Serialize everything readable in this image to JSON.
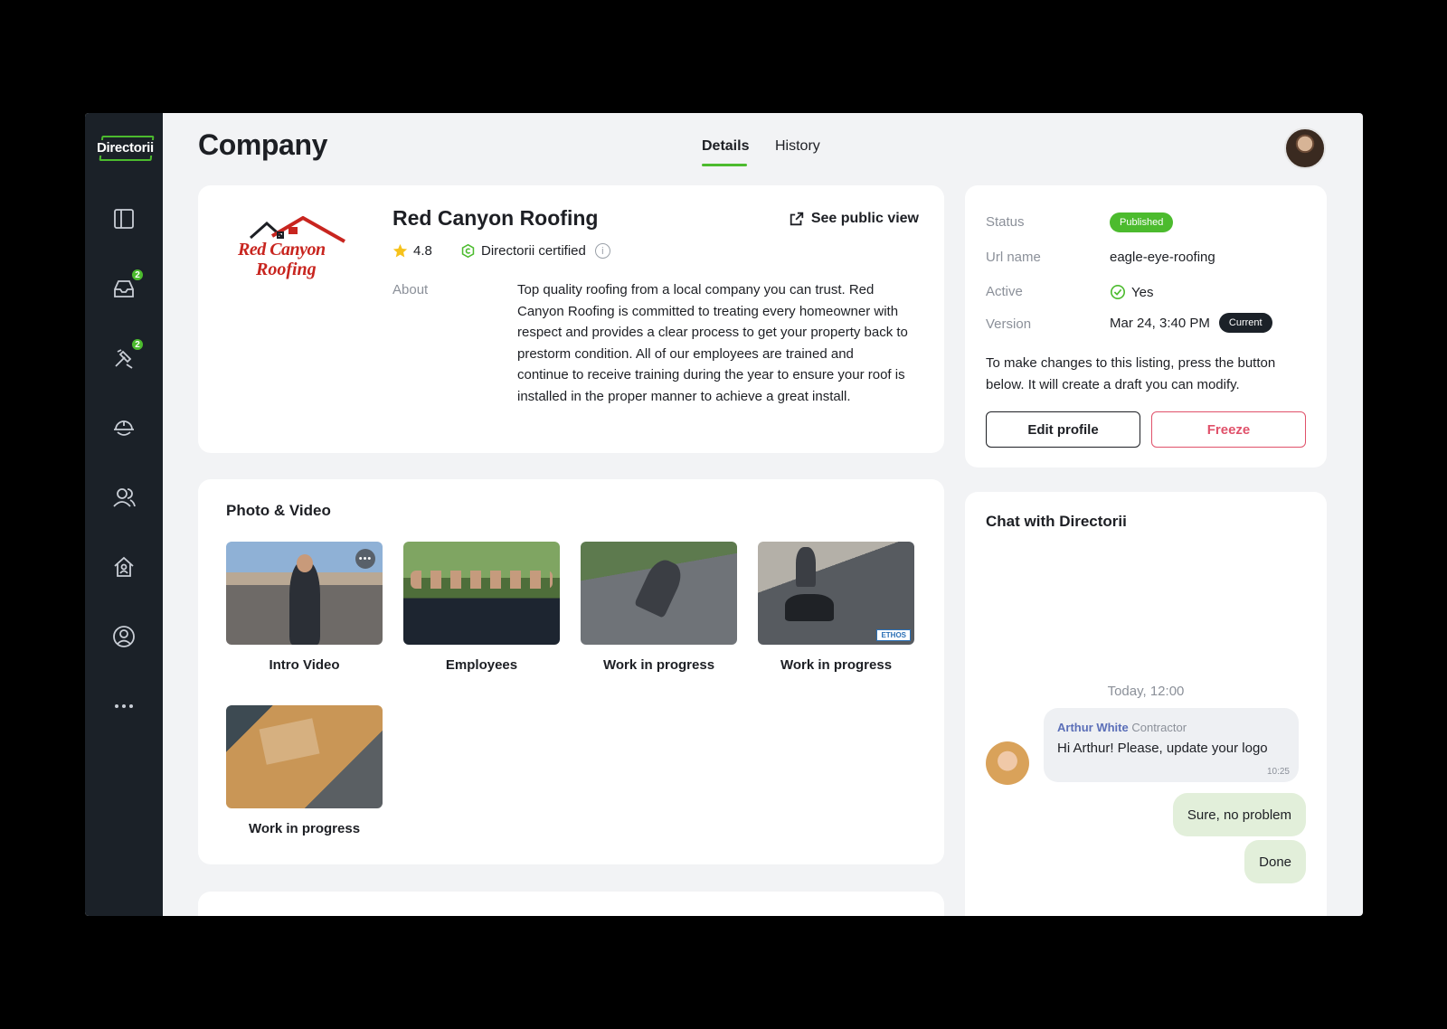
{
  "sidebar": {
    "logo_text": "Directorii",
    "items": [
      {
        "icon": "layout-panel-icon",
        "badge": ""
      },
      {
        "icon": "inbox-icon",
        "badge": "2"
      },
      {
        "icon": "tools-icon",
        "badge": "2"
      },
      {
        "icon": "hard-hat-icon",
        "badge": ""
      },
      {
        "icon": "users-icon",
        "badge": ""
      },
      {
        "icon": "home-icon",
        "badge": ""
      },
      {
        "icon": "profile-icon",
        "badge": ""
      },
      {
        "icon": "more-icon",
        "badge": ""
      }
    ]
  },
  "header": {
    "title": "Company",
    "tabs": [
      {
        "label": "Details",
        "active": true
      },
      {
        "label": "History",
        "active": false
      }
    ]
  },
  "company": {
    "logo_line1": "Red Canyon",
    "logo_line2": "Roofing",
    "name": "Red Canyon Roofing",
    "public_view_label": "See public view",
    "rating": "4.8",
    "certified_label": "Directorii certified",
    "about_label": "About",
    "about_text": "Top quality roofing from a local company you can trust. Red Canyon Roofing is committed to treating every homeowner with respect and provides a clear process to get your property back to prestorm condition. All of our employees are trained and continue to receive training during the year to ensure your roof is installed in the proper manner to achieve a great install."
  },
  "media": {
    "title": "Photo & Video",
    "items": [
      {
        "label": "Intro Video"
      },
      {
        "label": "Employees"
      },
      {
        "label": "Work in progress"
      },
      {
        "label": "Work in progress",
        "watermark": "ETHOS"
      },
      {
        "label": "Work in progress"
      }
    ]
  },
  "status": {
    "status_label": "Status",
    "status_value": "Published",
    "url_label": "Url name",
    "url_value": "eagle-eye-roofing",
    "active_label": "Active",
    "active_value": "Yes",
    "version_label": "Version",
    "version_value": "Mar 24, 3:40 PM",
    "version_badge": "Current",
    "note": "To make changes to this listing, press the button below. It will create a draft you can modify.",
    "edit_label": "Edit profile",
    "freeze_label": "Freeze"
  },
  "chat": {
    "title": "Chat with Directorii",
    "date_divider": "Today, 12:00",
    "incoming": {
      "sender_name": "Arthur White",
      "sender_role": "Contractor",
      "text": "Hi Arthur! Please, update your logo",
      "time": "10:25"
    },
    "outgoing": [
      "Sure, no problem",
      "Done"
    ]
  },
  "colors": {
    "accent_green": "#4cbb2e",
    "sidebar_bg": "#1b2128",
    "freeze_red": "#e0516a",
    "brand_red": "#c8251f"
  }
}
